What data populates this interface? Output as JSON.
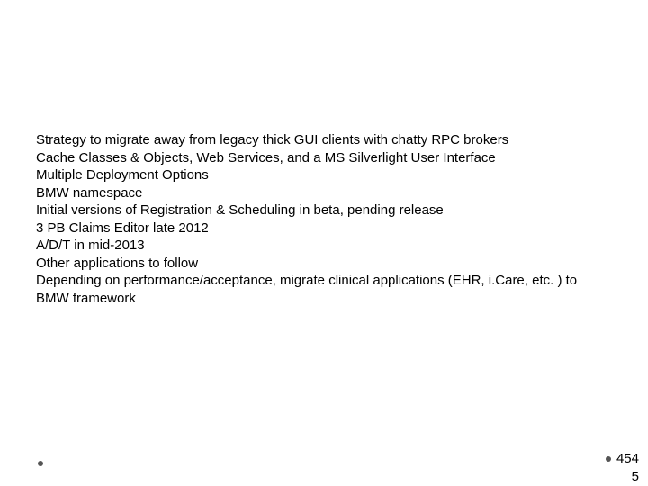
{
  "content": {
    "lines": [
      "Strategy to migrate away from legacy thick GUI clients with chatty RPC brokers",
      "Cache Classes & Objects, Web Services, and a MS Silverlight User Interface",
      "Multiple Deployment Options",
      "BMW namespace",
      "Initial versions of Registration & Scheduling in beta, pending release",
      "3 PB Claims Editor late 2012",
      "A/D/T in mid-2013",
      "Other applications to follow",
      "Depending on performance/acceptance, migrate clinical applications (EHR, i.Care, etc. ) to BMW framework"
    ]
  },
  "footer": {
    "page_number": "454",
    "corner_number": "5"
  }
}
